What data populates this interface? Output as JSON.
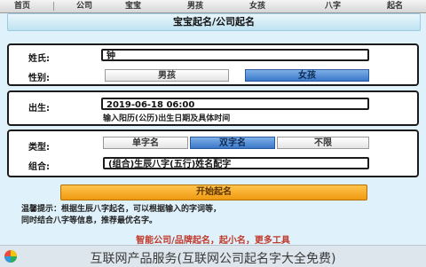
{
  "nav": {
    "items": [
      "首页",
      "公司",
      "宝宝",
      "男孩",
      "女孩",
      "八字",
      "起名"
    ]
  },
  "title": "宝宝起名/公司起名",
  "panel1": {
    "name_label": "姓氏:",
    "name_value": "钟",
    "gender_label": "性别:",
    "gender_options": [
      "男孩",
      "女孩"
    ],
    "gender_selected": 1
  },
  "panel2": {
    "birth_label": "出生:",
    "birth_value": "2019-06-18 06:00",
    "birth_hint": "输入阳历(公历)出生日期及具体时间"
  },
  "panel3": {
    "type_label": "类型:",
    "type_options": [
      "单字名",
      "双字名",
      "不限"
    ],
    "type_selected": 1,
    "mode_label": "组合:",
    "mode_value": "(组合)生辰八字(五行)姓名配字"
  },
  "cta_label": "开始起名",
  "note": {
    "text1": "温馨提示：根据生辰八字起名，可以根据输入的字词等，",
    "text2": "同时结合八字等信息，推荐最优名字。"
  },
  "promo": "智能公司/品牌起名，起小名，更多工具",
  "bottom_banner": "互联网产品服务(互联网公司起名字大全免费)",
  "colors": {
    "background": "#dff1fa",
    "accent": "#3a78c8",
    "cta": "#f09a10",
    "promo": "#c0392b"
  }
}
